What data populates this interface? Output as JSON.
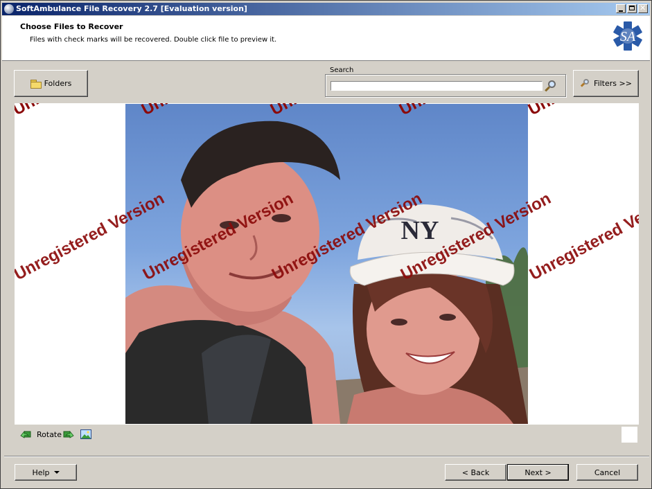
{
  "window": {
    "title": "SoftAmbulance File Recovery 2.7 [Evaluation version]"
  },
  "header": {
    "title": "Choose Files to Recover",
    "subtitle": "Files with check marks will be recovered. Double click file to preview it.",
    "logo_text": "SA"
  },
  "toolbar": {
    "folders_label": "Folders",
    "search_label": "Search",
    "search_value": "",
    "filters_label": "Filters >>"
  },
  "preview": {
    "watermark_text": "Unregistered Version",
    "watermark_partial": "Unre",
    "cap_text": "NY"
  },
  "image_tools": {
    "rotate_label": "Rotate"
  },
  "footer": {
    "help_label": "Help",
    "back_label": "< Back",
    "next_label": "Next >",
    "cancel_label": "Cancel"
  },
  "colors": {
    "titlebar_start": "#0a246a",
    "titlebar_end": "#a6caf0",
    "watermark": "#8b0a0a",
    "logo_blue": "#2a5aa8",
    "face": "#dc8f84",
    "cap": "#f0ece8"
  }
}
